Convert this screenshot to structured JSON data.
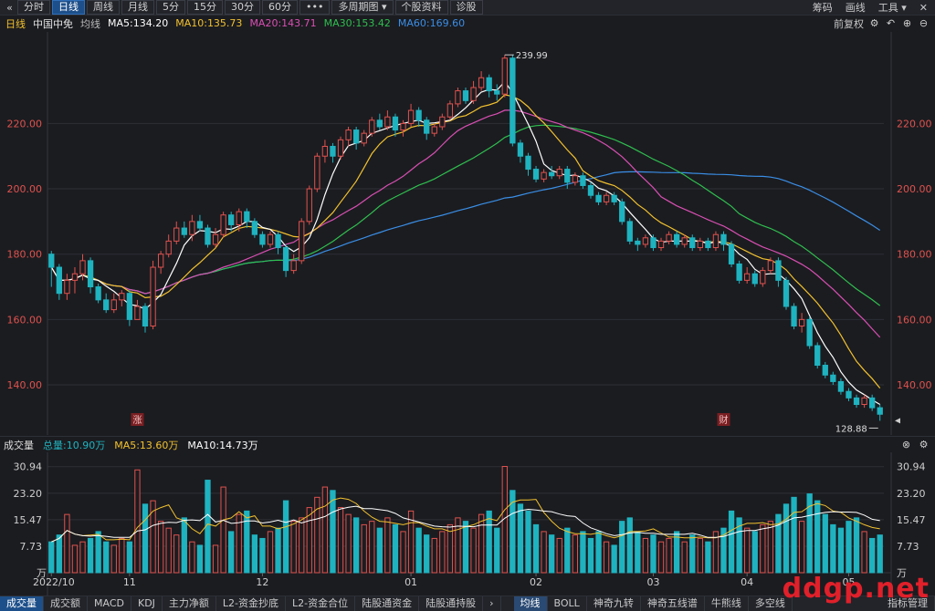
{
  "toolbar": {
    "back_icon": "double-chevron-left-icon",
    "tabs": [
      "分时",
      "日线",
      "周线",
      "月线",
      "5分",
      "15分",
      "30分",
      "60分"
    ],
    "active_tab": "日线",
    "more_label": "•••",
    "multi_period_label": "多周期图",
    "stock_info_label": "个股资料",
    "diagnose_label": "诊股",
    "right_items": [
      "筹码",
      "画线",
      "工具"
    ],
    "close_label": "✕"
  },
  "ma_bar": {
    "period_label": "日线",
    "stock_name": "中国中免",
    "ma_label": "均线",
    "ma5": "MA5:134.20",
    "ma10": "MA10:135.73",
    "ma20": "MA20:143.71",
    "ma30": "MA30:153.42",
    "ma60": "MA60:169.60",
    "adjust_label": "前复权",
    "colors": {
      "ma5": "#ffffff",
      "ma10": "#f2c12e",
      "ma20": "#d94fb3",
      "ma30": "#2fbf4f",
      "ma60": "#3a8ee6"
    }
  },
  "price_axis": {
    "ticks": [
      "220.00",
      "200.00",
      "180.00",
      "160.00",
      "140.00"
    ],
    "high_label": "239.99",
    "low_label": "128.88",
    "event_up": "涨",
    "event_fin": "财"
  },
  "volume_bar": {
    "label": "成交量",
    "total": "总量:10.90万",
    "ma5": "MA5:13.60万",
    "ma10": "MA10:14.73万"
  },
  "volume_axis": {
    "ticks": [
      "30.94",
      "23.20",
      "15.47",
      "7.73"
    ],
    "unit": "万"
  },
  "date_axis": [
    "2022/10",
    "11",
    "12",
    "01",
    "02",
    "03",
    "04",
    "05"
  ],
  "bottom_tabs": [
    "成交量",
    "成交额",
    "MACD",
    "KDJ",
    "主力净额",
    "L2-资金抄底",
    "L2-资金合位",
    "陆股通资金",
    "陆股通持股"
  ],
  "bottom_right_tabs": [
    "均线",
    "BOLL",
    "神奇九转",
    "神奇五线谱",
    "牛熊线",
    "多空线"
  ],
  "bottom_menu": "指标管理",
  "watermark": "ddgp.net",
  "chart_data": {
    "type": "candlestick",
    "price_range": [
      128,
      243
    ],
    "volume_range": [
      0,
      33
    ],
    "candles": [
      [
        180,
        176,
        181,
        170,
        9
      ],
      [
        176,
        168,
        177,
        166,
        11
      ],
      [
        168,
        172,
        174,
        166,
        17
      ],
      [
        172,
        174,
        176,
        168,
        8
      ],
      [
        174,
        178,
        180,
        172,
        9
      ],
      [
        178,
        170,
        179,
        168,
        10
      ],
      [
        170,
        166,
        171,
        165,
        12
      ],
      [
        166,
        163,
        168,
        162,
        9
      ],
      [
        163,
        166,
        168,
        162,
        8
      ],
      [
        166,
        168,
        169,
        164,
        10
      ],
      [
        168,
        160,
        169,
        158,
        9
      ],
      [
        160,
        164,
        166,
        160,
        30
      ],
      [
        164,
        158,
        165,
        156,
        20
      ],
      [
        158,
        176,
        178,
        157,
        21
      ],
      [
        176,
        180,
        181,
        174,
        15
      ],
      [
        180,
        184,
        186,
        179,
        13
      ],
      [
        184,
        188,
        190,
        183,
        11
      ],
      [
        188,
        186,
        190,
        185,
        16
      ],
      [
        186,
        190,
        192,
        184,
        9
      ],
      [
        190,
        188,
        192,
        187,
        8
      ],
      [
        188,
        183,
        189,
        182,
        27
      ],
      [
        183,
        186,
        188,
        182,
        8
      ],
      [
        186,
        192,
        193,
        185,
        25
      ],
      [
        192,
        189,
        193,
        187,
        12
      ],
      [
        189,
        193,
        194,
        187,
        17
      ],
      [
        193,
        190,
        194,
        188,
        18
      ],
      [
        190,
        186,
        191,
        185,
        11
      ],
      [
        186,
        183,
        187,
        182,
        10
      ],
      [
        183,
        186,
        187,
        182,
        12
      ],
      [
        186,
        182,
        187,
        180,
        13
      ],
      [
        182,
        175,
        183,
        173,
        21
      ],
      [
        175,
        178,
        180,
        174,
        15
      ],
      [
        178,
        190,
        191,
        177,
        16
      ],
      [
        190,
        200,
        201,
        189,
        19
      ],
      [
        200,
        210,
        211,
        199,
        22
      ],
      [
        210,
        213,
        215,
        208,
        25
      ],
      [
        213,
        210,
        214,
        208,
        24
      ],
      [
        210,
        215,
        216,
        209,
        19
      ],
      [
        215,
        218,
        219,
        213,
        17
      ],
      [
        218,
        214,
        219,
        212,
        16
      ],
      [
        214,
        217,
        218,
        213,
        14
      ],
      [
        217,
        221,
        222,
        216,
        15
      ],
      [
        221,
        219,
        223,
        218,
        13
      ],
      [
        219,
        222,
        224,
        218,
        16
      ],
      [
        222,
        218,
        223,
        216,
        14
      ],
      [
        218,
        220,
        221,
        216,
        12
      ],
      [
        220,
        224,
        226,
        219,
        18
      ],
      [
        224,
        221,
        225,
        219,
        13
      ],
      [
        221,
        217,
        222,
        215,
        11
      ],
      [
        217,
        219,
        220,
        216,
        10
      ],
      [
        219,
        222,
        223,
        218,
        12
      ],
      [
        222,
        226,
        227,
        221,
        14
      ],
      [
        226,
        230,
        231,
        225,
        16
      ],
      [
        230,
        227,
        231,
        226,
        15
      ],
      [
        227,
        231,
        233,
        226,
        13
      ],
      [
        231,
        234,
        236,
        230,
        17
      ],
      [
        234,
        230,
        235,
        228,
        18
      ],
      [
        230,
        229,
        232,
        227,
        13
      ],
      [
        229,
        240,
        241,
        228,
        31
      ],
      [
        240,
        214,
        241,
        213,
        24
      ],
      [
        214,
        210,
        215,
        208,
        20
      ],
      [
        210,
        206,
        211,
        204,
        18
      ],
      [
        206,
        203,
        207,
        202,
        14
      ],
      [
        203,
        205,
        206,
        202,
        12
      ],
      [
        205,
        204,
        207,
        203,
        11
      ],
      [
        204,
        206,
        207,
        203,
        10
      ],
      [
        206,
        202,
        207,
        200,
        13
      ],
      [
        202,
        204,
        205,
        201,
        11
      ],
      [
        204,
        201,
        205,
        200,
        12
      ],
      [
        201,
        198,
        202,
        197,
        10
      ],
      [
        198,
        196,
        199,
        195,
        12
      ],
      [
        196,
        198,
        199,
        195,
        9
      ],
      [
        198,
        196,
        199,
        195,
        8
      ],
      [
        196,
        190,
        197,
        189,
        15
      ],
      [
        190,
        184,
        191,
        183,
        16
      ],
      [
        184,
        183,
        185,
        181,
        12
      ],
      [
        183,
        185,
        186,
        182,
        10
      ],
      [
        185,
        182,
        186,
        181,
        11
      ],
      [
        182,
        184,
        185,
        181,
        9
      ],
      [
        184,
        186,
        187,
        183,
        10
      ],
      [
        186,
        183,
        187,
        182,
        12
      ],
      [
        183,
        185,
        186,
        182,
        9
      ],
      [
        185,
        182,
        186,
        181,
        11
      ],
      [
        182,
        184,
        185,
        181,
        10
      ],
      [
        184,
        182,
        185,
        181,
        9
      ],
      [
        182,
        186,
        187,
        181,
        12
      ],
      [
        186,
        183,
        187,
        181,
        13
      ],
      [
        183,
        177,
        184,
        176,
        18
      ],
      [
        177,
        172,
        178,
        171,
        16
      ],
      [
        172,
        174,
        176,
        171,
        13
      ],
      [
        174,
        171,
        175,
        170,
        12
      ],
      [
        171,
        175,
        176,
        170,
        14
      ],
      [
        175,
        178,
        179,
        174,
        15
      ],
      [
        178,
        172,
        179,
        170,
        17
      ],
      [
        172,
        164,
        173,
        163,
        20
      ],
      [
        164,
        158,
        165,
        157,
        22
      ],
      [
        158,
        160,
        162,
        156,
        15
      ],
      [
        160,
        152,
        161,
        151,
        23
      ],
      [
        152,
        146,
        153,
        145,
        21
      ],
      [
        146,
        143,
        147,
        142,
        17
      ],
      [
        143,
        141,
        144,
        140,
        14
      ],
      [
        141,
        138,
        142,
        137,
        13
      ],
      [
        138,
        136,
        139,
        135,
        15
      ],
      [
        136,
        134,
        137,
        133,
        16
      ],
      [
        134,
        136,
        137,
        133,
        12
      ],
      [
        136,
        133,
        137,
        132,
        10
      ],
      [
        133,
        131,
        134,
        129,
        11
      ]
    ],
    "ma_series": {
      "MA5": {
        "color": "#ffffff",
        "last": 134.2
      },
      "MA10": {
        "color": "#f2c12e",
        "last": 135.73
      },
      "MA20": {
        "color": "#d94fb3",
        "last": 143.71
      },
      "MA30": {
        "color": "#2fbf4f",
        "last": 153.42
      },
      "MA60": {
        "color": "#3a8ee6",
        "last": 169.6
      }
    }
  }
}
